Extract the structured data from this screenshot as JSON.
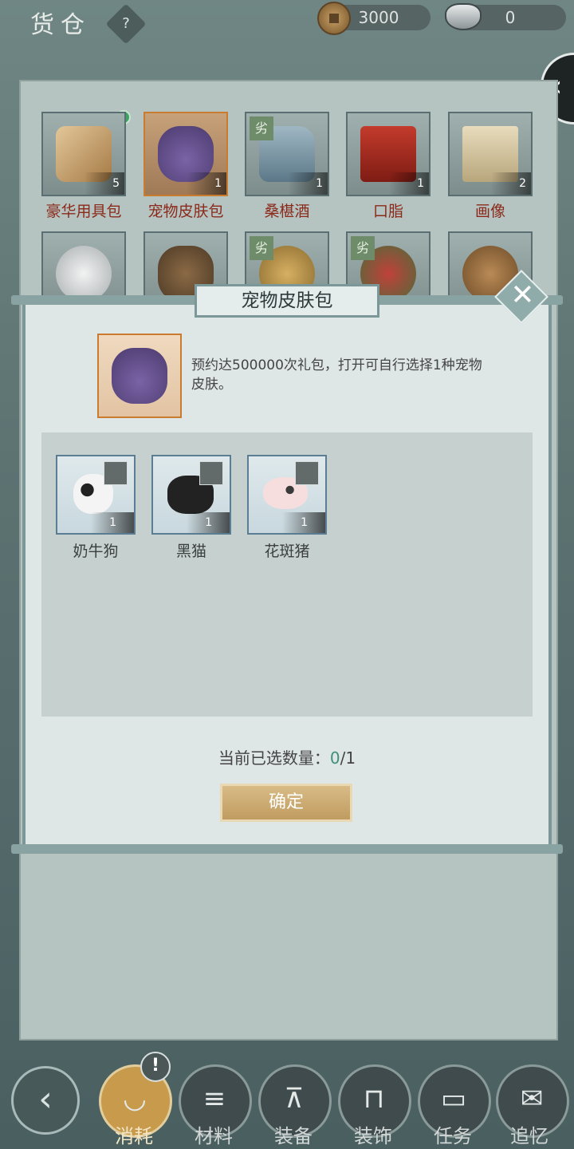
{
  "header": {
    "title": "货仓",
    "help_label": "?",
    "coins": "3000",
    "silver": "0"
  },
  "inventory": {
    "items": [
      {
        "name": "豪华用具包",
        "count": "5"
      },
      {
        "name": "宠物皮肤包",
        "count": "1"
      },
      {
        "name": "桑椹酒",
        "count": "1",
        "badge": "劣"
      },
      {
        "name": "口脂",
        "count": "1"
      },
      {
        "name": "画像",
        "count": "2"
      }
    ],
    "row2_badges": [
      "劣",
      "劣"
    ]
  },
  "modal": {
    "title": "宠物皮肤包",
    "description": "预约达500000次礼包，打开可自行选择1种宠物皮肤。",
    "skins": [
      {
        "name": "奶牛狗",
        "count": "1"
      },
      {
        "name": "黑猫",
        "count": "1"
      },
      {
        "name": "花斑猪",
        "count": "1"
      }
    ],
    "selected_label": "当前已选数量：",
    "selected_current": "0",
    "selected_total": "/1",
    "confirm_label": "确定",
    "close_label": "✕"
  },
  "bottom_nav": {
    "back_label": "‹",
    "alert_label": "!",
    "tabs": [
      {
        "label": "消耗",
        "icon": "bowl-icon",
        "active": true
      },
      {
        "label": "材料",
        "icon": "logs-icon",
        "active": false
      },
      {
        "label": "装备",
        "icon": "robe-icon",
        "active": false
      },
      {
        "label": "装饰",
        "icon": "fence-icon",
        "active": false
      },
      {
        "label": "任务",
        "icon": "book-icon",
        "active": false
      },
      {
        "label": "追忆",
        "icon": "letter-icon",
        "active": false
      }
    ]
  },
  "colors": {
    "accent_gold": "#c79a4c",
    "name_red": "#8b2a1a",
    "count_green": "#3f8f7b",
    "selected_border": "#c97c2f"
  }
}
